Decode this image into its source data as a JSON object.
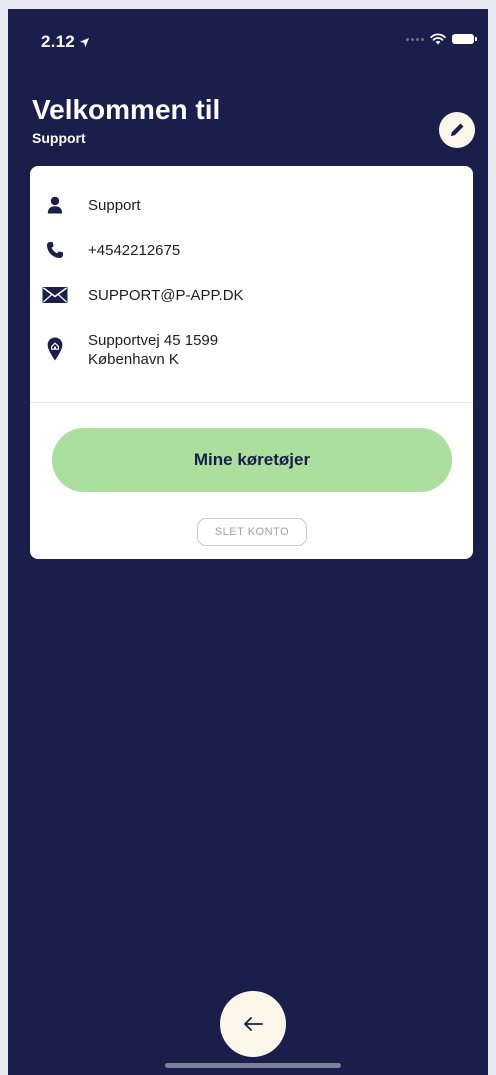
{
  "status_bar": {
    "time": "2.12"
  },
  "header": {
    "title": "Velkommen til",
    "subtitle": "Support"
  },
  "profile": {
    "name": "Support",
    "phone": "+4542212675",
    "email": "SUPPORT@P-APP.DK",
    "address_line1": "Supportvej 45 1599",
    "address_line2": "København K"
  },
  "actions": {
    "vehicles_label": "Mine køretøjer",
    "delete_label": "SLET KONTO"
  },
  "icons": {
    "edit": "pencil-icon",
    "person": "person-icon",
    "phone": "phone-icon",
    "email": "envelope-icon",
    "address": "map-pin-icon",
    "back": "arrow-left-icon",
    "location": "location-arrow-icon",
    "wifi": "wifi-icon",
    "battery": "battery-icon"
  },
  "colors": {
    "background": "#1a1e4a",
    "accent_green": "#abdf9e",
    "cream": "#fbf6ea",
    "card": "#ffffff",
    "text_dark": "#1c1c2c"
  }
}
